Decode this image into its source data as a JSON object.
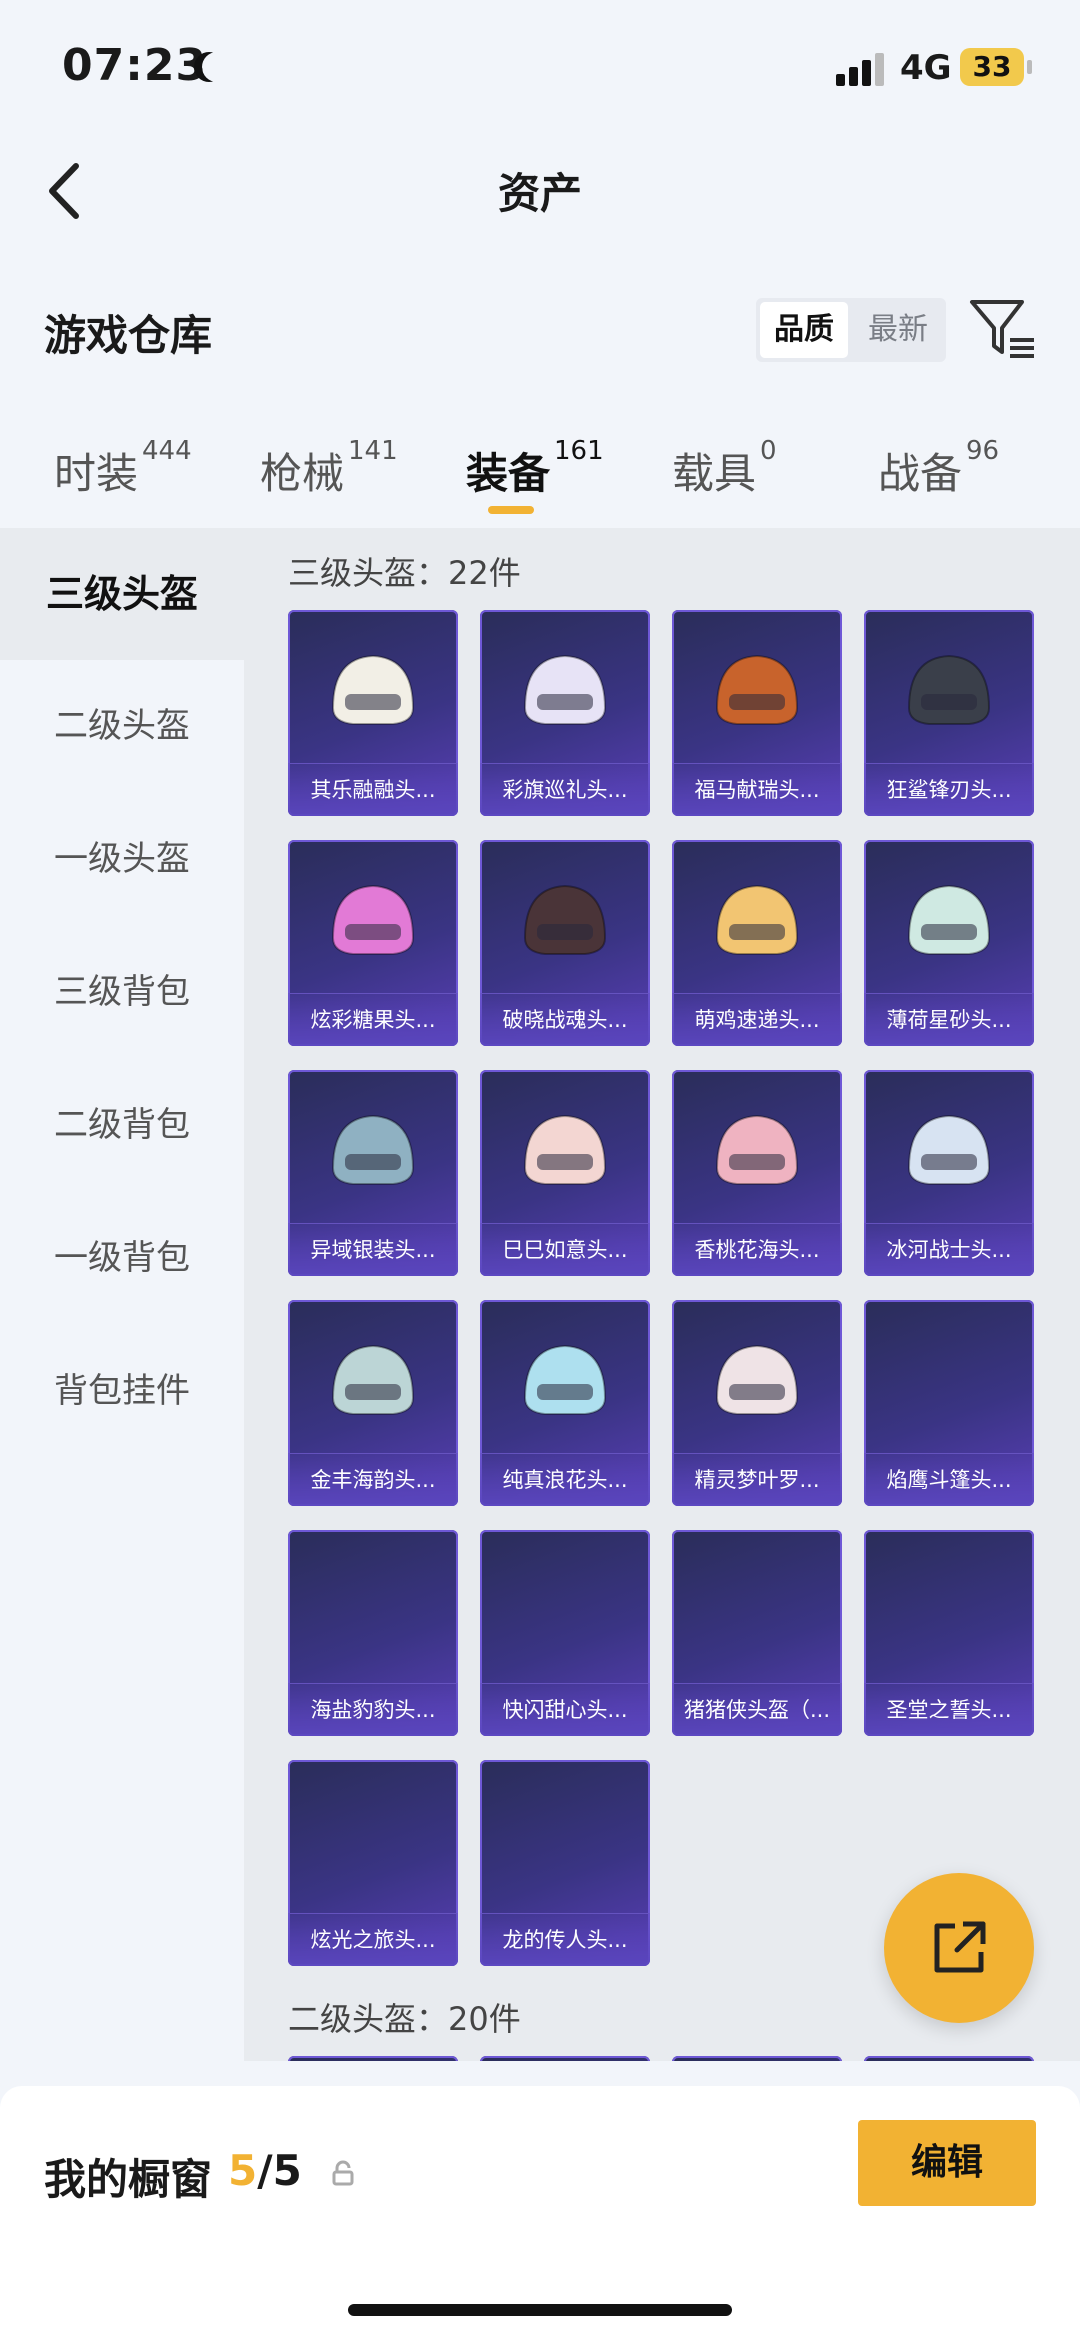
{
  "status_bar": {
    "time": "07:23",
    "network": "4G",
    "battery": "33"
  },
  "header": {
    "title": "资产"
  },
  "warehouse": {
    "title": "游戏仓库",
    "sort_quality": "品质",
    "sort_latest": "最新"
  },
  "tabs": [
    {
      "label": "时装",
      "count": "444"
    },
    {
      "label": "枪械",
      "count": "141"
    },
    {
      "label": "装备",
      "count": "161"
    },
    {
      "label": "载具",
      "count": "0"
    },
    {
      "label": "战备",
      "count": "96"
    }
  ],
  "sidebar": [
    {
      "label": "三级头盔"
    },
    {
      "label": "二级头盔"
    },
    {
      "label": "一级头盔"
    },
    {
      "label": "三级背包"
    },
    {
      "label": "二级背包"
    },
    {
      "label": "一级背包"
    },
    {
      "label": "背包挂件"
    }
  ],
  "sections": [
    {
      "title": "三级头盔：22件",
      "items": [
        {
          "label": "其乐融融头...",
          "color": "#f2efe6"
        },
        {
          "label": "彩旗巡礼头...",
          "color": "#e7e3f6"
        },
        {
          "label": "福马献瑞头...",
          "color": "#c8632c"
        },
        {
          "label": "狂鲨锋刃头...",
          "color": "#3a3f4a"
        },
        {
          "label": "炫彩糖果头...",
          "color": "#e27ad6"
        },
        {
          "label": "破晓战魂头...",
          "color": "#4a3438"
        },
        {
          "label": "萌鸡速递头...",
          "color": "#f2c572"
        },
        {
          "label": "薄荷星砂头...",
          "color": "#cfe9e2"
        },
        {
          "label": "异域银装头...",
          "color": "#8fb1c2"
        },
        {
          "label": "巳巳如意头...",
          "color": "#f3d6d2"
        },
        {
          "label": "香桃花海头...",
          "color": "#efb3c1"
        },
        {
          "label": "冰河战士头...",
          "color": "#d7e3f2"
        },
        {
          "label": "金丰海韵头...",
          "color": "#bcd5d6"
        },
        {
          "label": "纯真浪花头...",
          "color": "#aee0ef"
        },
        {
          "label": "精灵梦叶罗...",
          "color": "#efe3e6"
        },
        {
          "label": "焰鹰斗篷头...",
          "color": ""
        },
        {
          "label": "海盐豹豹头...",
          "color": ""
        },
        {
          "label": "快闪甜心头...",
          "color": ""
        },
        {
          "label": "猪猪侠头盔（...",
          "color": ""
        },
        {
          "label": "圣堂之誓头...",
          "color": ""
        },
        {
          "label": "炫光之旅头...",
          "color": ""
        },
        {
          "label": "龙的传人头...",
          "color": ""
        }
      ]
    },
    {
      "title": "二级头盔：20件",
      "items": []
    }
  ],
  "showcase": {
    "label": "我的橱窗",
    "count_current": "5",
    "count_total": "/5",
    "edit_label": "编辑"
  },
  "colors": {
    "accent": "#f2b233",
    "card_bg": "#3a3484"
  }
}
